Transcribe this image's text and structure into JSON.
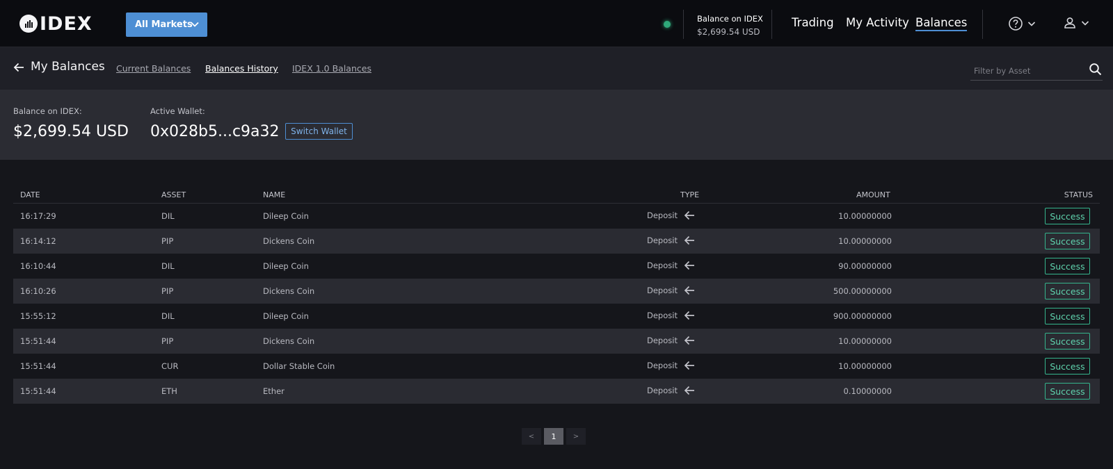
{
  "brand": {
    "logo_text": "IDEX"
  },
  "header": {
    "markets_button": "All Markets",
    "balance_label": "Balance on IDEX",
    "balance_value": "$2,699.54 USD",
    "nav": [
      {
        "label": "Trading",
        "active": false
      },
      {
        "label": "My Activity",
        "active": false
      },
      {
        "label": "Balances",
        "active": true
      }
    ],
    "icons": [
      "help-icon",
      "user-icon"
    ]
  },
  "subheader": {
    "title": "My Balances",
    "tabs": [
      {
        "label": "Current Balances",
        "active": false
      },
      {
        "label": "Balances History",
        "active": true
      },
      {
        "label": "IDEX 1.0 Balances",
        "active": false
      }
    ],
    "filter_placeholder": "Filter by Asset"
  },
  "balance_panel": {
    "balance_label": "Balance on IDEX:",
    "balance_value": "$2,699.54 USD",
    "wallet_label": "Active Wallet:",
    "wallet_value": "0x028b5...c9a32",
    "switch_button": "Switch Wallet"
  },
  "table": {
    "columns": [
      "DATE",
      "ASSET",
      "NAME",
      "TYPE",
      "AMOUNT",
      "STATUS"
    ],
    "rows": [
      {
        "date": "16:17:29",
        "asset": "DIL",
        "name": "Dileep Coin",
        "type": "Deposit",
        "amount": "10.00000000",
        "status": "Success"
      },
      {
        "date": "16:14:12",
        "asset": "PIP",
        "name": "Dickens Coin",
        "type": "Deposit",
        "amount": "10.00000000",
        "status": "Success"
      },
      {
        "date": "16:10:44",
        "asset": "DIL",
        "name": "Dileep Coin",
        "type": "Deposit",
        "amount": "90.00000000",
        "status": "Success"
      },
      {
        "date": "16:10:26",
        "asset": "PIP",
        "name": "Dickens Coin",
        "type": "Deposit",
        "amount": "500.00000000",
        "status": "Success"
      },
      {
        "date": "15:55:12",
        "asset": "DIL",
        "name": "Dileep Coin",
        "type": "Deposit",
        "amount": "900.00000000",
        "status": "Success"
      },
      {
        "date": "15:51:44",
        "asset": "PIP",
        "name": "Dickens Coin",
        "type": "Deposit",
        "amount": "10.00000000",
        "status": "Success"
      },
      {
        "date": "15:51:44",
        "asset": "CUR",
        "name": "Dollar Stable Coin",
        "type": "Deposit",
        "amount": "10.00000000",
        "status": "Success"
      },
      {
        "date": "15:51:44",
        "asset": "ETH",
        "name": "Ether",
        "type": "Deposit",
        "amount": "0.10000000",
        "status": "Success"
      }
    ]
  },
  "pagination": {
    "prev": "<",
    "current": "1",
    "next": ">"
  },
  "colors": {
    "accent": "#4e8fd4",
    "success": "#35b58d",
    "background": "#15161b"
  }
}
